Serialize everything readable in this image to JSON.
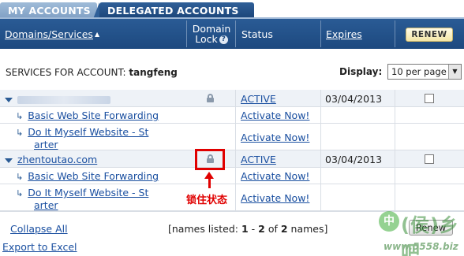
{
  "tabs": {
    "my_accounts": "MY ACCOUNTS",
    "delegated_accounts": "DELEGATED ACCOUNTS"
  },
  "header": {
    "domains_services": "Domains/Services",
    "domain_lock_line1": "Domain",
    "domain_lock_line2": "Lock",
    "status": "Status",
    "expires": "Expires",
    "renew": "RENEW"
  },
  "services": {
    "label": "SERVICES FOR ACCOUNT:",
    "account": "tangfeng",
    "display_label": "Display:",
    "per_page_value": "10 per page"
  },
  "rows": [
    {
      "name": "",
      "status": "ACTIVE",
      "expires": "03/04/2013"
    },
    {
      "name": "Basic Web Site Forwarding",
      "status": "Activate Now!"
    },
    {
      "name": "Do It Myself Website - St",
      "name_cont": "arter",
      "status": "Activate Now!"
    },
    {
      "name": "zhentoutao.com",
      "status": "ACTIVE",
      "expires": "03/04/2013"
    },
    {
      "name": "Basic Web Site Forwarding",
      "status": "Activate Now!"
    },
    {
      "name": "Do It Myself Website - St",
      "name_cont": "arter",
      "status": "Activate Now!"
    }
  ],
  "annotation": {
    "text": "锁住状态",
    "color": "#e00000"
  },
  "footer": {
    "collapse_all": "Collapse All",
    "names_prefix": "[names listed: ",
    "range_start": "1",
    "range_sep": " - ",
    "range_end": "2",
    "of": " of ",
    "total": "2",
    "names_suffix": " names]",
    "renew_button": "Renew",
    "export": "Export to Excel"
  },
  "watermark": {
    "glyph": "中",
    "big": "(侯)乡吧",
    "url": "www.5558.biz"
  },
  "colors": {
    "header_bg": "#1d497f",
    "link": "#1a4fa0",
    "alt_row": "#eef2f7",
    "annotation": "#e00000"
  }
}
